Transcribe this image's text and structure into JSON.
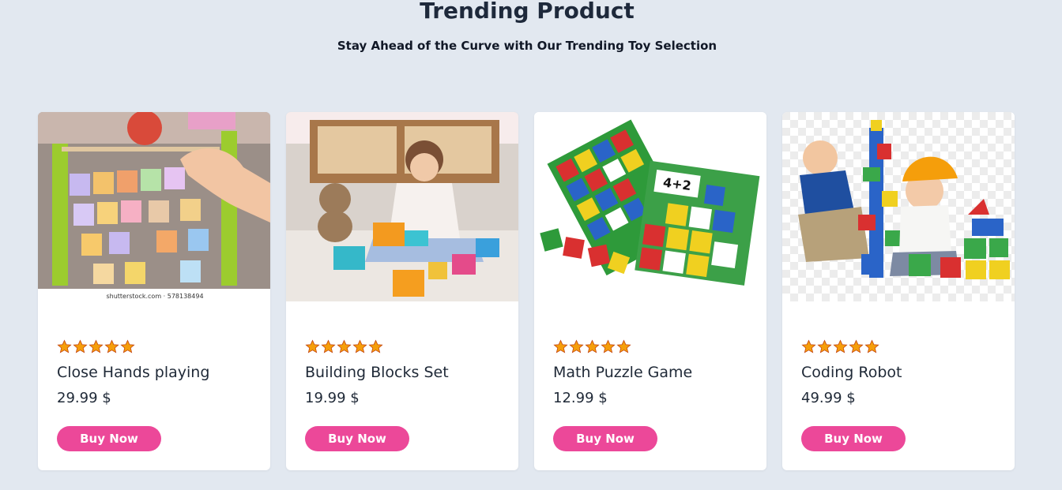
{
  "section": {
    "title": "Trending Product",
    "subtitle": "Stay Ahead of the Curve with Our Trending Toy Selection"
  },
  "colors": {
    "accent": "#ec4899",
    "star": "#f59e0b",
    "background": "#e2e8f0"
  },
  "products": [
    {
      "name": "Close Hands playing",
      "price": "29.99 $",
      "rating": 5,
      "button": "Buy Now",
      "image": "wooden-alphabet-abacus-photo",
      "watermark": "shutterstock.com · 578138494"
    },
    {
      "name": "Building Blocks Set",
      "price": "19.99 $",
      "rating": 5,
      "button": "Buy Now",
      "image": "girl-playing-blocks-photo"
    },
    {
      "name": "Math Puzzle Game",
      "price": "12.99 $",
      "rating": 5,
      "button": "Buy Now",
      "image": "math-number-tiles-photo"
    },
    {
      "name": "Coding Robot",
      "price": "49.99 $",
      "rating": 5,
      "button": "Buy Now",
      "image": "toddlers-building-tower-photo"
    }
  ]
}
